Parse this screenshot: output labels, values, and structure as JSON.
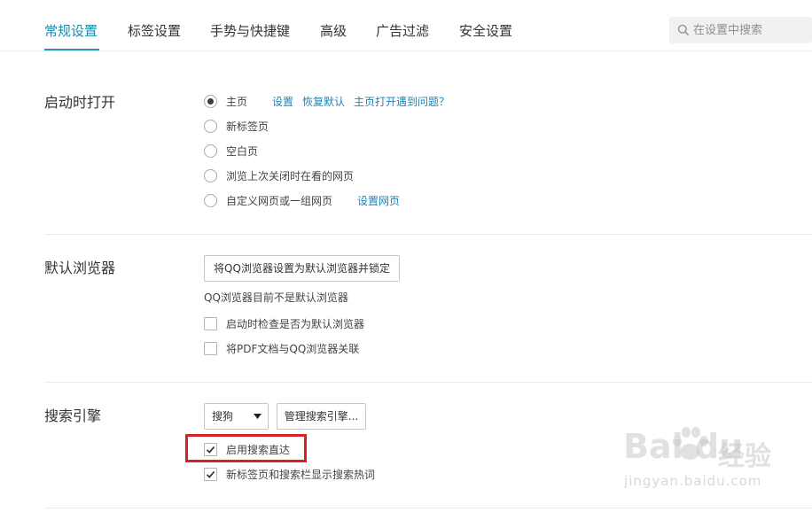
{
  "tabs": [
    {
      "label": "常规设置",
      "active": true
    },
    {
      "label": "标签设置",
      "active": false
    },
    {
      "label": "手势与快捷键",
      "active": false
    },
    {
      "label": "高级",
      "active": false
    },
    {
      "label": "广告过滤",
      "active": false
    },
    {
      "label": "安全设置",
      "active": false
    }
  ],
  "search": {
    "placeholder": "在设置中搜索",
    "icon": "search-icon"
  },
  "startup": {
    "title": "启动时打开",
    "options": [
      {
        "label": "主页",
        "checked": true
      },
      {
        "label": "新标签页",
        "checked": false
      },
      {
        "label": "空白页",
        "checked": false
      },
      {
        "label": "浏览上次关闭时在看的网页",
        "checked": false
      },
      {
        "label": "自定义网页或一组网页",
        "checked": false
      }
    ],
    "homepage_links": [
      "设置",
      "恢复默认",
      "主页打开遇到问题？"
    ],
    "custom_link": "设置网页"
  },
  "default_browser": {
    "title": "默认浏览器",
    "set_button": "将QQ浏览器设置为默认浏览器并锁定",
    "status": "QQ浏览器目前不是默认浏览器",
    "checkboxes": [
      {
        "label": "启动时检查是否为默认浏览器",
        "checked": false
      },
      {
        "label": "将PDF文档与QQ浏览器关联",
        "checked": false
      }
    ]
  },
  "search_engine": {
    "title": "搜索引擎",
    "selected": "搜狗",
    "manage_button": "管理搜索引擎...",
    "checkboxes": [
      {
        "label": "启用搜索直达",
        "checked": true,
        "highlighted": true
      },
      {
        "label": "新标签页和搜索栏显示搜索热词",
        "checked": true
      }
    ]
  },
  "colors": {
    "accent": "#1f8ba8",
    "link": "#1e84b8",
    "highlight": "#d62222"
  },
  "watermark": {
    "brand": "Bai  du",
    "cn": "经验",
    "url": "jingyan.baidu.com"
  }
}
